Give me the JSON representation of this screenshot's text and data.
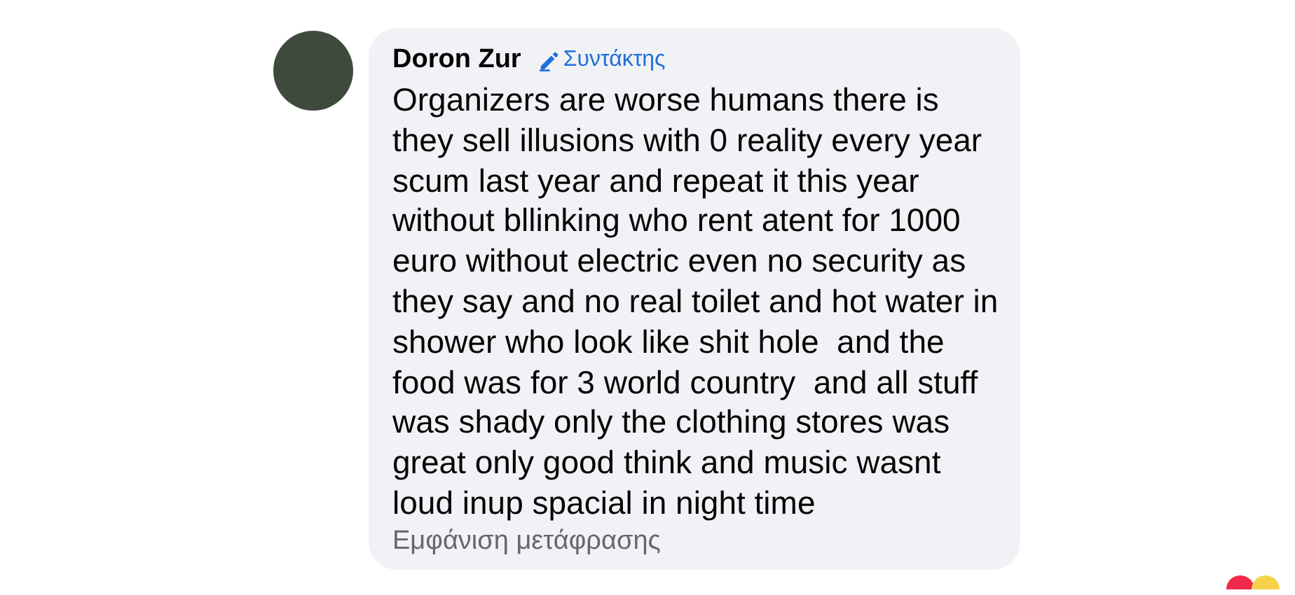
{
  "comment": {
    "author": "Doron Zur",
    "badge": "Συντάκτης",
    "text": "Organizers are worse humans there is\nthey sell illusions with 0 reality every year\nscum last year and repeat it this year\nwithout bllinking who rent atent for 1000\neuro without electric even no security as\nthey say and no real toilet and hot water in\nshower who look like shit hole  and the\nfood was for 3 world country  and all stuff\nwas shady only the clothing stores was\ngreat only good think and music wasnt\nloud inup spacial in night time",
    "translation_link": "Εμφάνιση μετάφρασης",
    "reactions": [
      {
        "color": "#f0284a"
      },
      {
        "color": "#f7d14b"
      }
    ]
  }
}
